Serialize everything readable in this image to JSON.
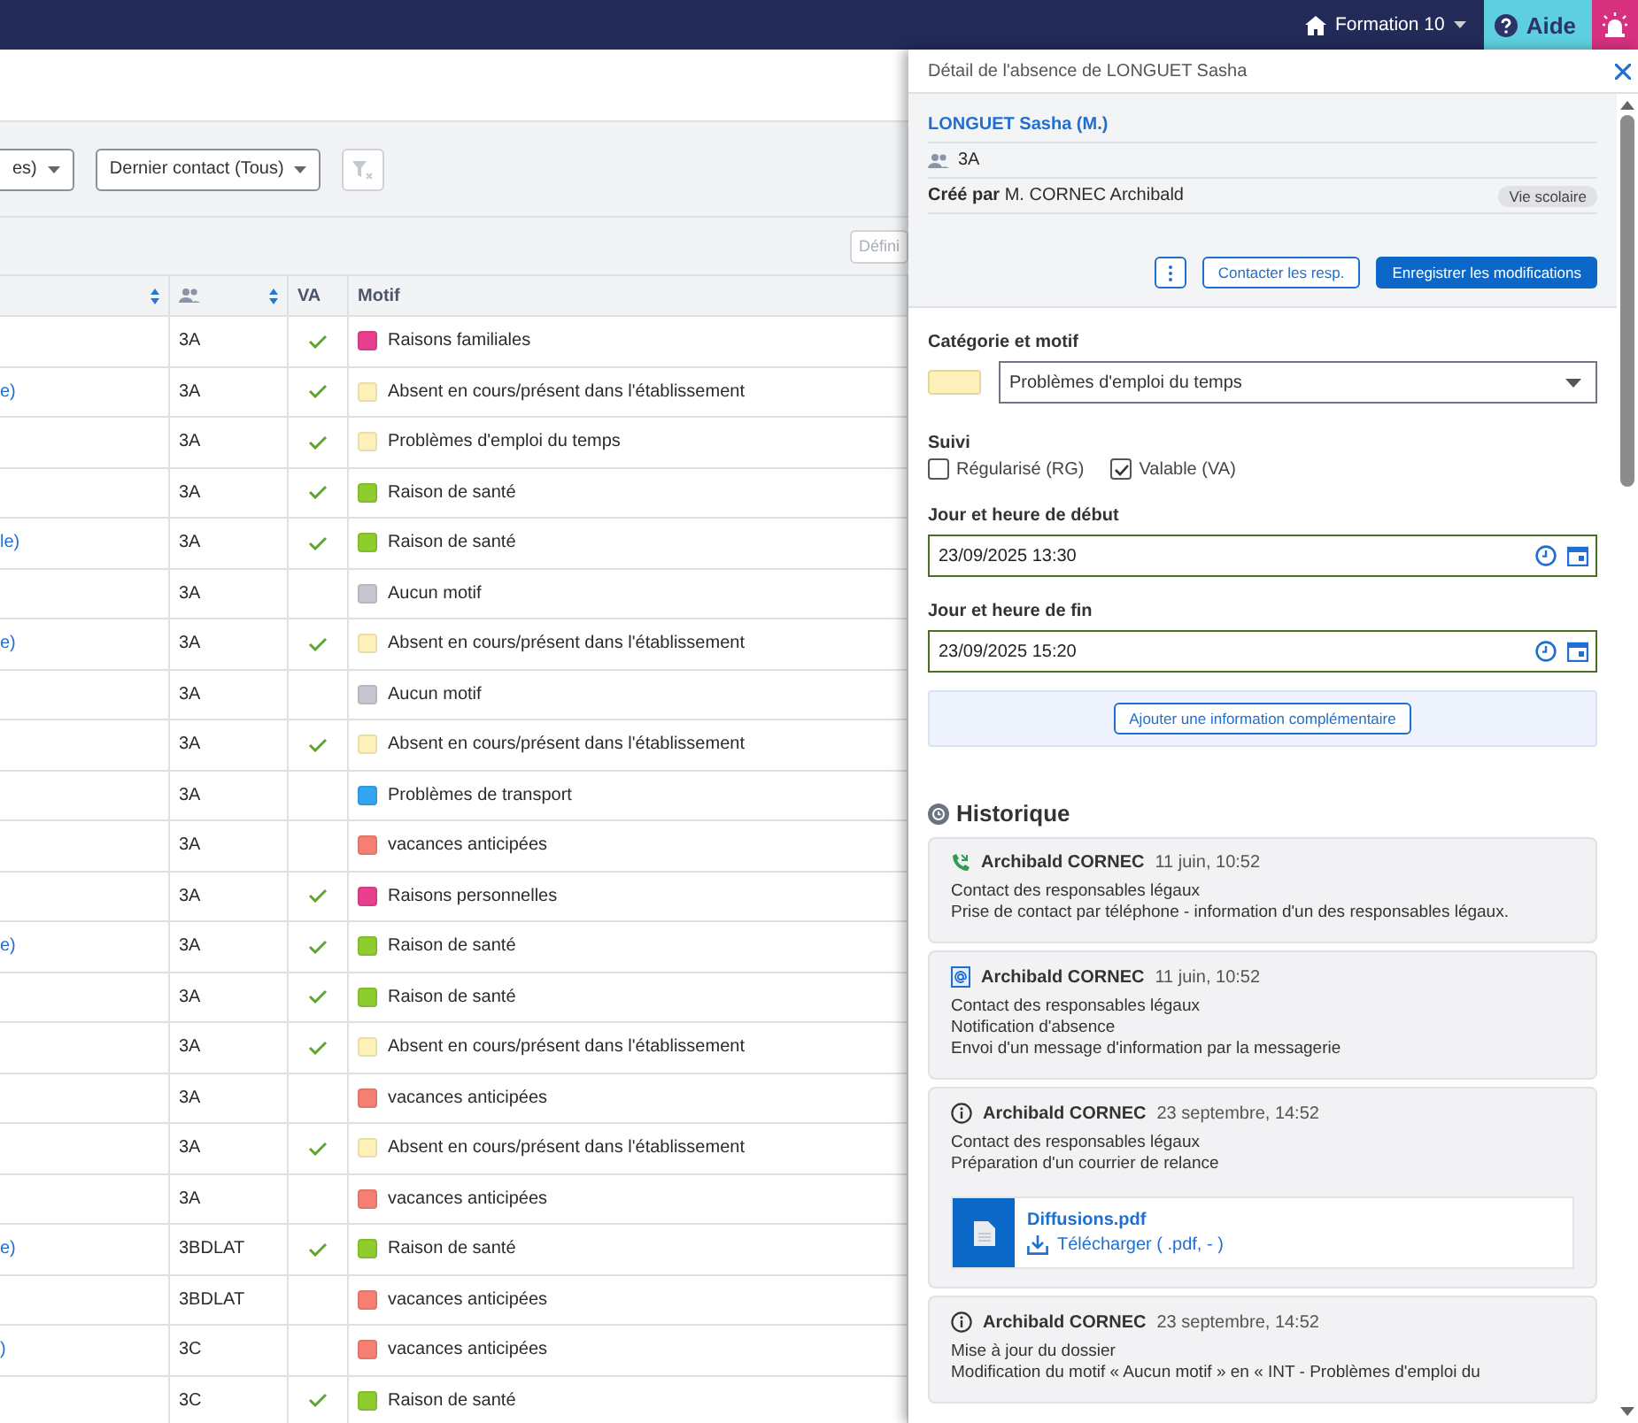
{
  "top_bar": {
    "establishment": "Formation 10",
    "help": "Aide"
  },
  "filters": {
    "dropdowns": [
      {
        "label": "es)"
      },
      {
        "label": "Dernier contact (Tous)"
      }
    ],
    "define_button": "Défini"
  },
  "table": {
    "columns": [
      {
        "kind": "sort"
      },
      {
        "kind": "group"
      },
      {
        "label": "VA",
        "kind": "plain"
      },
      {
        "label": "Motif",
        "kind": "plain"
      }
    ],
    "rows": [
      {
        "column_1": "",
        "group": "3A",
        "va": true,
        "motif": "Raisons familiales",
        "color": "#e8408f"
      },
      {
        "column_1": "e)",
        "group": "3A",
        "va": true,
        "motif": "Absent en cours/présent dans l'établissement",
        "color": "#fdf0b8"
      },
      {
        "column_1": "",
        "group": "3A",
        "va": true,
        "motif": "Problèmes d'emploi du temps",
        "color": "#fdf0b8"
      },
      {
        "column_1": "",
        "group": "3A",
        "va": true,
        "motif": "Raison de santé",
        "color": "#8fcc2e"
      },
      {
        "column_1": "le)",
        "group": "3A",
        "va": true,
        "motif": "Raison de santé",
        "color": "#8fcc2e"
      },
      {
        "column_1": "",
        "group": "3A",
        "va": false,
        "motif": "Aucun motif",
        "color": "#c6c7d0"
      },
      {
        "column_1": "e)",
        "group": "3A",
        "va": true,
        "motif": "Absent en cours/présent dans l'établissement",
        "color": "#fdf0b8"
      },
      {
        "column_1": "",
        "group": "3A",
        "va": false,
        "motif": "Aucun motif",
        "color": "#c6c7d0"
      },
      {
        "column_1": "",
        "group": "3A",
        "va": true,
        "motif": "Absent en cours/présent dans l'établissement",
        "color": "#fdf0b8"
      },
      {
        "column_1": "",
        "group": "3A",
        "va": false,
        "motif": "Problèmes de transport",
        "color": "#33a6f2"
      },
      {
        "column_1": "",
        "group": "3A",
        "va": false,
        "motif": "vacances anticipées",
        "color": "#f57f73"
      },
      {
        "column_1": "",
        "group": "3A",
        "va": true,
        "motif": "Raisons personnelles",
        "color": "#e8408f"
      },
      {
        "column_1": "e)",
        "group": "3A",
        "va": true,
        "motif": "Raison de santé",
        "color": "#8fcc2e"
      },
      {
        "column_1": "",
        "group": "3A",
        "va": true,
        "motif": "Raison de santé",
        "color": "#8fcc2e"
      },
      {
        "column_1": "",
        "group": "3A",
        "va": true,
        "motif": "Absent en cours/présent dans l'établissement",
        "color": "#fdf0b8"
      },
      {
        "column_1": "",
        "group": "3A",
        "va": false,
        "motif": "vacances anticipées",
        "color": "#f57f73"
      },
      {
        "column_1": "",
        "group": "3A",
        "va": true,
        "motif": "Absent en cours/présent dans l'établissement",
        "color": "#fdf0b8"
      },
      {
        "column_1": "",
        "group": "3A",
        "va": false,
        "motif": "vacances anticipées",
        "color": "#f57f73"
      },
      {
        "column_1": "e)",
        "group": "3BDLAT",
        "va": true,
        "motif": "Raison de santé",
        "color": "#8fcc2e"
      },
      {
        "column_1": "",
        "group": "3BDLAT",
        "va": false,
        "motif": "vacances anticipées",
        "color": "#f57f73"
      },
      {
        "column_1": ")",
        "group": "3C",
        "va": false,
        "motif": "vacances anticipées",
        "color": "#f57f73"
      },
      {
        "column_1": "",
        "group": "3C",
        "va": true,
        "motif": "Raison de santé",
        "color": "#8fcc2e"
      }
    ]
  },
  "panel": {
    "title": "Détail de l'absence de LONGUET Sasha",
    "student": "LONGUET Sasha (M.)",
    "group": "3A",
    "created_by": "**Créé par** M. CORNEC Archibald",
    "badge": "Vie scolaire",
    "buttons": {
      "contact": "Contacter les resp.",
      "save": "Enregistrer les modifications"
    },
    "category": {
      "label": "Catégorie et motif",
      "color": "#fdf0b8",
      "value": "Problèmes d'emploi du temps"
    },
    "follow_up": {
      "label": "Suivi",
      "options": [
        {
          "label": "Régularisé (RG)",
          "checked": false
        },
        {
          "label": "Valable (VA)",
          "checked": true
        }
      ]
    },
    "start": {
      "label": "Jour et heure de début",
      "value": "23/09/2025 13:30"
    },
    "end": {
      "label": "Jour et heure de fin",
      "value": "23/09/2025 15:20"
    },
    "add_info_button": "Ajouter une information complémentaire",
    "history": {
      "title": "Historique",
      "entries": [
        {
          "kind": "phone",
          "author": "Archibald CORNEC",
          "date": "11 juin, 10:52",
          "lines": [
            "Contact des responsables légaux",
            "Prise de contact par téléphone - information d'un des responsables légaux."
          ]
        },
        {
          "kind": "mail",
          "author": "Archibald CORNEC",
          "date": "11 juin, 10:52",
          "lines": [
            "Contact des responsables légaux",
            "Notification d'absence",
            "Envoi d'un message d'information par la messagerie"
          ]
        },
        {
          "kind": "info",
          "author": "Archibald CORNEC",
          "date": "23 septembre, 14:52",
          "lines": [
            "Contact des responsables légaux",
            "Préparation d'un courrier de relance"
          ],
          "attachment": {
            "name": "Diffusions.pdf",
            "download": "Télécharger ( .pdf, - )"
          }
        },
        {
          "kind": "info",
          "author": "Archibald CORNEC",
          "date": "23 septembre, 14:52",
          "lines": [
            "Mise à jour du dossier",
            "Modification du motif « Aucun motif » en « INT - Problèmes d'emploi du"
          ]
        }
      ]
    }
  }
}
